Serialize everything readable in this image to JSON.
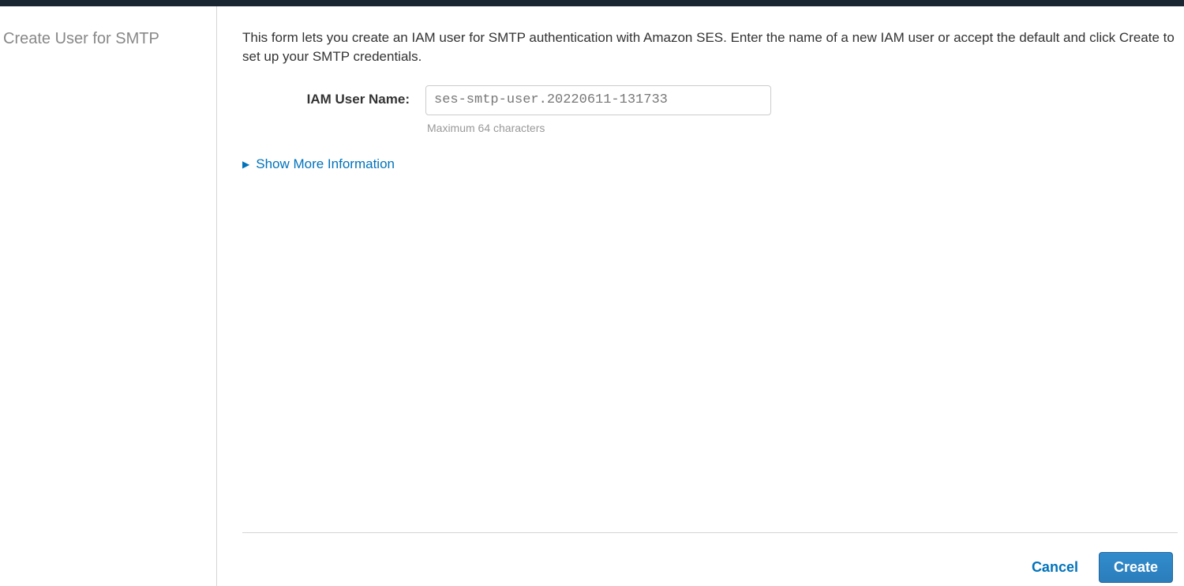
{
  "sidebar": {
    "title": "Create User for SMTP"
  },
  "main": {
    "description": "This form lets you create an IAM user for SMTP authentication with Amazon SES. Enter the name of a new IAM user or accept the default and click Create to set up your SMTP credentials.",
    "form": {
      "iam_user_label": "IAM User Name:",
      "iam_user_value": "ses-smtp-user.20220611-131733",
      "iam_user_hint": "Maximum 64 characters"
    },
    "show_more_label": "Show More Information"
  },
  "footer": {
    "cancel_label": "Cancel",
    "create_label": "Create"
  }
}
